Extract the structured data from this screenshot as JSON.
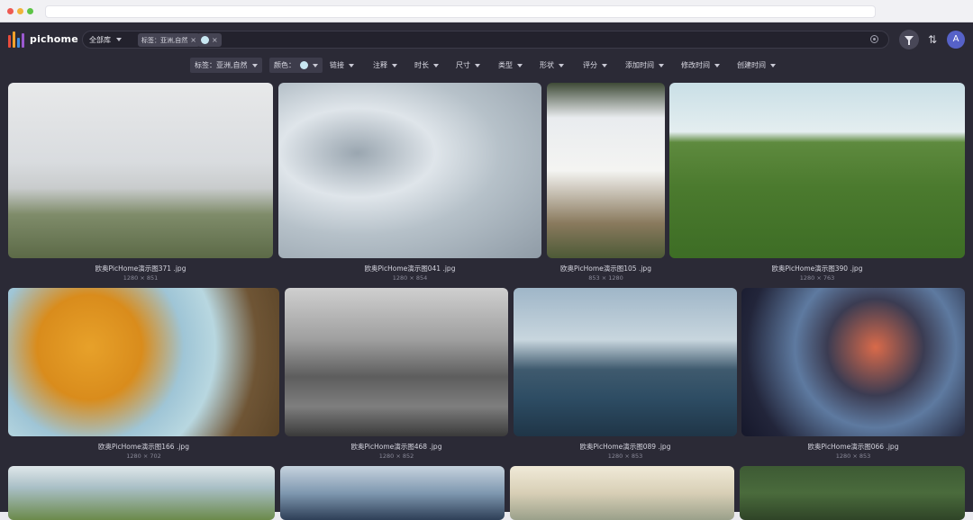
{
  "app": {
    "name": "pichome"
  },
  "search": {
    "library": "全部库",
    "chips": [
      "标签：亚洲,自然",
      ""
    ]
  },
  "toolbar": {
    "filter_icon": "funnel-icon",
    "sort_icon": "sort-icon",
    "avatar_letter": "A"
  },
  "filters": [
    {
      "label": "标签：亚洲,自然",
      "active": true
    },
    {
      "label": "颜色：",
      "active": true,
      "swatch": "#c8e7f2"
    },
    {
      "label": "链接"
    },
    {
      "label": "注释"
    },
    {
      "label": "时长"
    },
    {
      "label": "尺寸"
    },
    {
      "label": "类型"
    },
    {
      "label": "形状"
    },
    {
      "label": "评分"
    },
    {
      "label": "添加时间"
    },
    {
      "label": "修改时间"
    },
    {
      "label": "创建时间"
    }
  ],
  "images": [
    {
      "name": "欧奥PicHome演示图371 .jpg",
      "dims": "1280 × 851"
    },
    {
      "name": "欧奥PicHome演示图041 .jpg",
      "dims": "1280 × 854"
    },
    {
      "name": "欧奥PicHome演示图105 .jpg",
      "dims": "853 × 1280"
    },
    {
      "name": "欧奥PicHome演示图390 .jpg",
      "dims": "1280 × 763"
    },
    {
      "name": "欧奥PicHome演示图166 .jpg",
      "dims": "1280 × 702"
    },
    {
      "name": "欧奥PicHome演示图468 .jpg",
      "dims": "1280 × 852"
    },
    {
      "name": "欧奥PicHome演示图089 .jpg",
      "dims": "1280 × 853"
    },
    {
      "name": "欧奥PicHome演示图066 .jpg",
      "dims": "1280 × 853"
    }
  ]
}
